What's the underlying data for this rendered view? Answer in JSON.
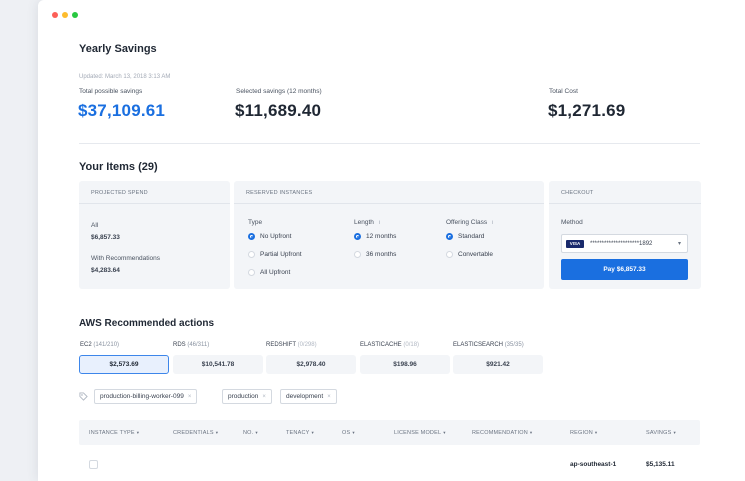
{
  "header": {
    "title": "Yearly Savings",
    "updated": "Updated: March 13, 2018 3:13 AM",
    "total_possible_label": "Total possible savings",
    "total_possible_value": "$37,109.61",
    "selected_label": "Selected savings (12 months)",
    "selected_value": "$11,689.40",
    "total_cost_label": "Total Cost",
    "total_cost_value": "$1,271.69"
  },
  "items": {
    "title": "Your Items (29)",
    "projected": {
      "heading": "PROJECTED SPEND",
      "all_label": "All",
      "all_value": "$6,857.33",
      "rec_label": "With Recommendations",
      "rec_value": "$4,283.64"
    },
    "reserved": {
      "heading": "RESERVED INSTANCES",
      "type_label": "Type",
      "type_options": [
        "No Upfront",
        "Partial Upfront",
        "All Upfront"
      ],
      "type_selected": "No Upfront",
      "length_label": "Length",
      "length_options": [
        "12 months",
        "36 months"
      ],
      "length_selected": "12 months",
      "class_label": "Offering Class",
      "class_options": [
        "Standard",
        "Convertable"
      ],
      "class_selected": "Standard",
      "info_glyph": "i"
    },
    "checkout": {
      "heading": "CHECKOUT",
      "method_label": "Method",
      "card_brand": "VISA",
      "card_number": "*********************1892",
      "dropdown_glyph": "▾",
      "pay_label": "Pay $6,857.33"
    }
  },
  "actions": {
    "title": "AWS Recommended actions",
    "tabs": [
      {
        "name": "EC2",
        "count": "(141/210)",
        "value": "$2,573.69",
        "active": true
      },
      {
        "name": "RDS",
        "count": "(46/311)",
        "value": "$10,541.78",
        "active": false
      },
      {
        "name": "REDSHIFT",
        "count": "(0/298)",
        "value": "$2,978.40",
        "active": false
      },
      {
        "name": "ELASTICACHE",
        "count": "(0/18)",
        "value": "$198.96",
        "active": false
      },
      {
        "name": "ELASTICSEARCH",
        "count": "(35/35)",
        "value": "$921.42",
        "active": false
      }
    ],
    "filter_chips": [
      "production-billing-worker-099",
      "production",
      "development"
    ],
    "chip_remove_glyph": "×"
  },
  "table": {
    "columns": [
      "INSTANCE TYPE",
      "CREDENTIALS",
      "NO.",
      "TENACY",
      "OS",
      "LICENSE MODEL",
      "RECOMMENDATION",
      "REGION",
      "SAVINGS"
    ],
    "caret": "▾",
    "rows": [
      {
        "region": "ap-southeast-1",
        "savings": "$5,135.11"
      }
    ]
  },
  "colors": {
    "accent": "#1a6fe0",
    "highlight_value": "#1a6fe0",
    "dot_red": "#fc5f57",
    "dot_yellow": "#fdbc2e",
    "dot_green": "#28c840"
  },
  "icons": {
    "tag_icon": "tag-icon"
  }
}
